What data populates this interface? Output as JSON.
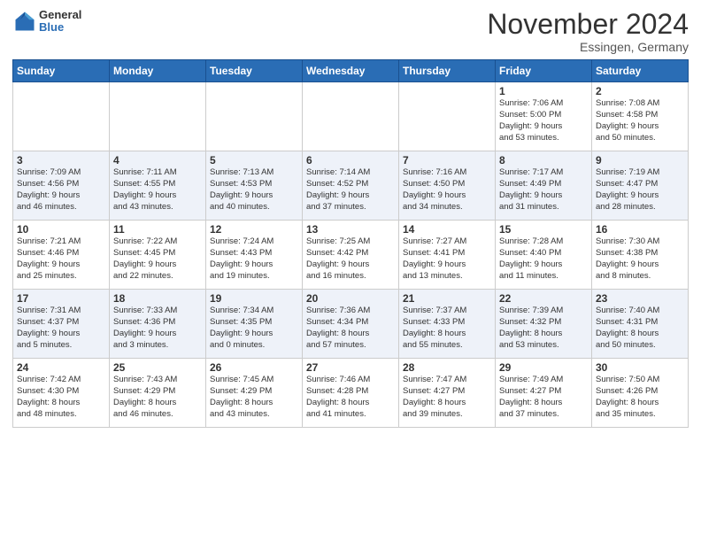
{
  "logo": {
    "general": "General",
    "blue": "Blue"
  },
  "header": {
    "month": "November 2024",
    "location": "Essingen, Germany"
  },
  "weekdays": [
    "Sunday",
    "Monday",
    "Tuesday",
    "Wednesday",
    "Thursday",
    "Friday",
    "Saturday"
  ],
  "weeks": [
    [
      {
        "day": "",
        "info": ""
      },
      {
        "day": "",
        "info": ""
      },
      {
        "day": "",
        "info": ""
      },
      {
        "day": "",
        "info": ""
      },
      {
        "day": "",
        "info": ""
      },
      {
        "day": "1",
        "info": "Sunrise: 7:06 AM\nSunset: 5:00 PM\nDaylight: 9 hours\nand 53 minutes."
      },
      {
        "day": "2",
        "info": "Sunrise: 7:08 AM\nSunset: 4:58 PM\nDaylight: 9 hours\nand 50 minutes."
      }
    ],
    [
      {
        "day": "3",
        "info": "Sunrise: 7:09 AM\nSunset: 4:56 PM\nDaylight: 9 hours\nand 46 minutes."
      },
      {
        "day": "4",
        "info": "Sunrise: 7:11 AM\nSunset: 4:55 PM\nDaylight: 9 hours\nand 43 minutes."
      },
      {
        "day": "5",
        "info": "Sunrise: 7:13 AM\nSunset: 4:53 PM\nDaylight: 9 hours\nand 40 minutes."
      },
      {
        "day": "6",
        "info": "Sunrise: 7:14 AM\nSunset: 4:52 PM\nDaylight: 9 hours\nand 37 minutes."
      },
      {
        "day": "7",
        "info": "Sunrise: 7:16 AM\nSunset: 4:50 PM\nDaylight: 9 hours\nand 34 minutes."
      },
      {
        "day": "8",
        "info": "Sunrise: 7:17 AM\nSunset: 4:49 PM\nDaylight: 9 hours\nand 31 minutes."
      },
      {
        "day": "9",
        "info": "Sunrise: 7:19 AM\nSunset: 4:47 PM\nDaylight: 9 hours\nand 28 minutes."
      }
    ],
    [
      {
        "day": "10",
        "info": "Sunrise: 7:21 AM\nSunset: 4:46 PM\nDaylight: 9 hours\nand 25 minutes."
      },
      {
        "day": "11",
        "info": "Sunrise: 7:22 AM\nSunset: 4:45 PM\nDaylight: 9 hours\nand 22 minutes."
      },
      {
        "day": "12",
        "info": "Sunrise: 7:24 AM\nSunset: 4:43 PM\nDaylight: 9 hours\nand 19 minutes."
      },
      {
        "day": "13",
        "info": "Sunrise: 7:25 AM\nSunset: 4:42 PM\nDaylight: 9 hours\nand 16 minutes."
      },
      {
        "day": "14",
        "info": "Sunrise: 7:27 AM\nSunset: 4:41 PM\nDaylight: 9 hours\nand 13 minutes."
      },
      {
        "day": "15",
        "info": "Sunrise: 7:28 AM\nSunset: 4:40 PM\nDaylight: 9 hours\nand 11 minutes."
      },
      {
        "day": "16",
        "info": "Sunrise: 7:30 AM\nSunset: 4:38 PM\nDaylight: 9 hours\nand 8 minutes."
      }
    ],
    [
      {
        "day": "17",
        "info": "Sunrise: 7:31 AM\nSunset: 4:37 PM\nDaylight: 9 hours\nand 5 minutes."
      },
      {
        "day": "18",
        "info": "Sunrise: 7:33 AM\nSunset: 4:36 PM\nDaylight: 9 hours\nand 3 minutes."
      },
      {
        "day": "19",
        "info": "Sunrise: 7:34 AM\nSunset: 4:35 PM\nDaylight: 9 hours\nand 0 minutes."
      },
      {
        "day": "20",
        "info": "Sunrise: 7:36 AM\nSunset: 4:34 PM\nDaylight: 8 hours\nand 57 minutes."
      },
      {
        "day": "21",
        "info": "Sunrise: 7:37 AM\nSunset: 4:33 PM\nDaylight: 8 hours\nand 55 minutes."
      },
      {
        "day": "22",
        "info": "Sunrise: 7:39 AM\nSunset: 4:32 PM\nDaylight: 8 hours\nand 53 minutes."
      },
      {
        "day": "23",
        "info": "Sunrise: 7:40 AM\nSunset: 4:31 PM\nDaylight: 8 hours\nand 50 minutes."
      }
    ],
    [
      {
        "day": "24",
        "info": "Sunrise: 7:42 AM\nSunset: 4:30 PM\nDaylight: 8 hours\nand 48 minutes."
      },
      {
        "day": "25",
        "info": "Sunrise: 7:43 AM\nSunset: 4:29 PM\nDaylight: 8 hours\nand 46 minutes."
      },
      {
        "day": "26",
        "info": "Sunrise: 7:45 AM\nSunset: 4:29 PM\nDaylight: 8 hours\nand 43 minutes."
      },
      {
        "day": "27",
        "info": "Sunrise: 7:46 AM\nSunset: 4:28 PM\nDaylight: 8 hours\nand 41 minutes."
      },
      {
        "day": "28",
        "info": "Sunrise: 7:47 AM\nSunset: 4:27 PM\nDaylight: 8 hours\nand 39 minutes."
      },
      {
        "day": "29",
        "info": "Sunrise: 7:49 AM\nSunset: 4:27 PM\nDaylight: 8 hours\nand 37 minutes."
      },
      {
        "day": "30",
        "info": "Sunrise: 7:50 AM\nSunset: 4:26 PM\nDaylight: 8 hours\nand 35 minutes."
      }
    ]
  ]
}
